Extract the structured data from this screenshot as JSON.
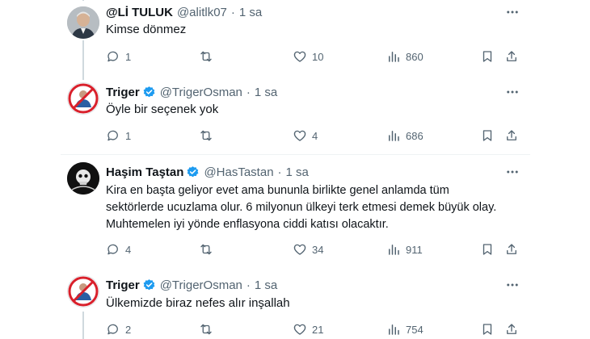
{
  "tweets": [
    {
      "display_name": "@Lİ TULUK",
      "handle": "@alitlk07",
      "time": "1 sa",
      "verified": false,
      "lines": [
        "Kimse dönmez"
      ],
      "replies": "1",
      "retweets": "",
      "likes": "10",
      "views": "860"
    },
    {
      "display_name": "Triger",
      "handle": "@TrigerOsman",
      "time": "1 sa",
      "verified": true,
      "lines": [
        "Öyle bir seçenek yok"
      ],
      "replies": "1",
      "retweets": "",
      "likes": "4",
      "views": "686"
    },
    {
      "display_name": "Haşim Taştan",
      "handle": "@HasTastan",
      "time": "1 sa",
      "verified": true,
      "lines": [
        "Kira en başta geliyor evet ama bununla birlikte genel anlamda tüm",
        "sektörlerde ucuzlama olur. 6 milyonun ülkeyi terk etmesi demek büyük olay.",
        "Muhtemelen iyi yönde enflasyona ciddi katısı olacaktır."
      ],
      "replies": "4",
      "retweets": "",
      "likes": "34",
      "views": "911"
    },
    {
      "display_name": "Triger",
      "handle": "@TrigerOsman",
      "time": "1 sa",
      "verified": true,
      "lines": [
        "Ülkemizde biraz nefes alır inşallah"
      ],
      "replies": "2",
      "retweets": "",
      "likes": "21",
      "views": "754"
    }
  ],
  "separator": "·",
  "icons": {
    "reply": "reply-icon",
    "retweet": "retweet-icon",
    "like": "heart-icon",
    "views": "views-icon",
    "bookmark": "bookmark-icon",
    "share": "share-icon",
    "more": "more-icon",
    "verified": "verified-badge-icon"
  },
  "colors": {
    "text": "#0f1419",
    "secondary": "#536471",
    "verified": "#1d9bf0",
    "line": "#cfd9de"
  }
}
